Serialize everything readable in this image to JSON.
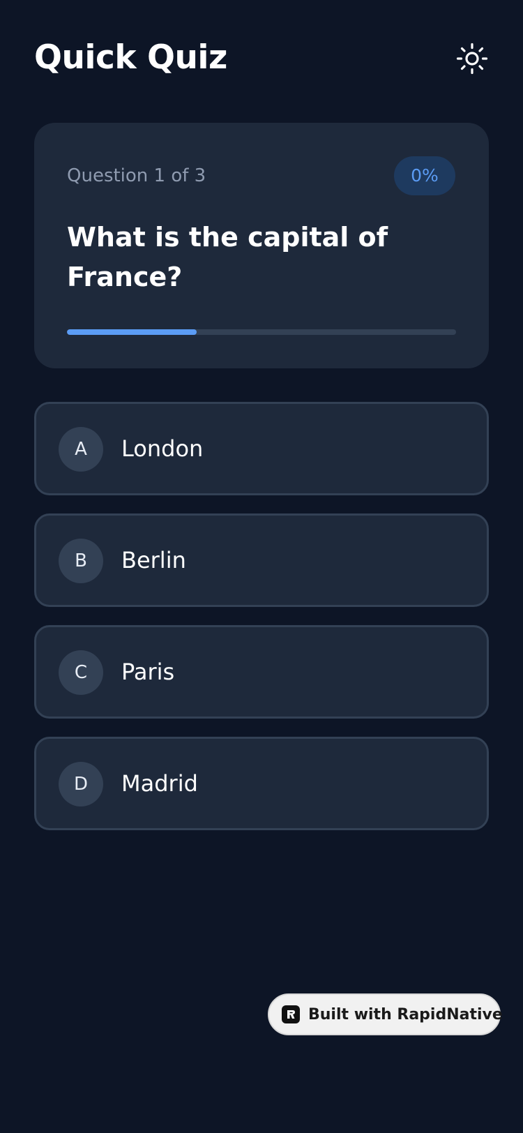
{
  "header": {
    "title": "Quick Quiz",
    "theme_toggle_icon": "sun-icon"
  },
  "question_card": {
    "counter": "Question 1 of 3",
    "score_badge": "0%",
    "question": "What is the capital of France?",
    "progress_fraction": 0.333
  },
  "options": [
    {
      "letter": "A",
      "label": "London"
    },
    {
      "letter": "B",
      "label": "Berlin"
    },
    {
      "letter": "C",
      "label": "Paris"
    },
    {
      "letter": "D",
      "label": "Madrid"
    }
  ],
  "footer": {
    "built_with": "Built with RapidNative",
    "logo_icon": "rapidnative-logo-icon"
  },
  "colors": {
    "background": "#0d1526",
    "card": "#1e293b",
    "accent": "#5b9cf5",
    "border": "#334155",
    "muted_text": "#8f9bb0"
  }
}
